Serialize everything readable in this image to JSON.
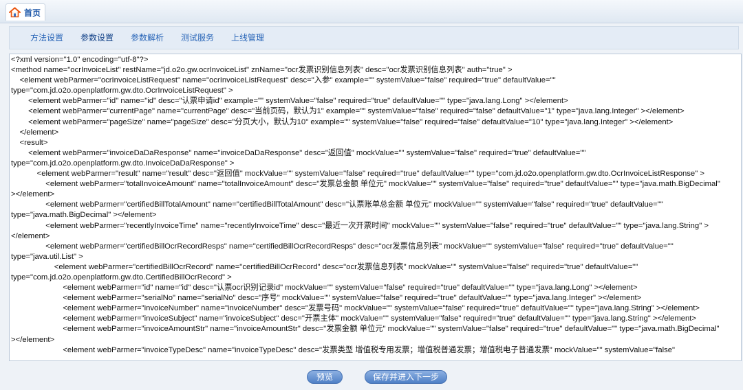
{
  "header": {
    "home_label": "首页",
    "home_icon": "home-icon"
  },
  "tabs": [
    {
      "label": "方法设置"
    },
    {
      "label": "参数设置"
    },
    {
      "label": "参数解析"
    },
    {
      "label": "测试服务"
    },
    {
      "label": "上线管理"
    }
  ],
  "active_tab": "参数设置",
  "editor": {
    "content": "<?xml version=\"1.0\" encoding=\"utf-8\"?>\n<method name=\"ocrInvoiceList\" restName=\"jd.o2o.gw.ocrInvoiceList\" znName=\"ocr发票识别信息列表\" desc=\"ocr发票识别信息列表\" auth=\"true\" >\n    <element webParmer=\"ocrInvoiceListRequest\" name=\"ocrInvoiceListRequest\" desc=\"入参\" example=\"\" systemValue=\"false\" required=\"true\" defaultValue=\"\"\ntype=\"com.jd.o2o.openplatform.gw.dto.OcrInvoiceListRequest\" >\n        <element webParmer=\"id\" name=\"id\" desc=\"认票申请id\" example=\"\" systemValue=\"false\" required=\"true\" defaultValue=\"\" type=\"java.lang.Long\" ></element>\n        <element webParmer=\"currentPage\" name=\"currentPage\" desc=\"当前页码，默认为1\" example=\"\" systemValue=\"false\" required=\"false\" defaultValue=\"1\" type=\"java.lang.Integer\" ></element>\n        <element webParmer=\"pageSize\" name=\"pageSize\" desc=\"分页大小，默认为10\" example=\"\" systemValue=\"false\" required=\"false\" defaultValue=\"10\" type=\"java.lang.Integer\" ></element>\n    </element>\n    <result>\n        <element webParmer=\"invoiceDaDaResponse\" name=\"invoiceDaDaResponse\" desc=\"返回值\" mockValue=\"\" systemValue=\"false\" required=\"true\" defaultValue=\"\"\ntype=\"com.jd.o2o.openplatform.gw.dto.InvoiceDaDaResponse\" >\n            <element webParmer=\"result\" name=\"result\" desc=\"返回值\" mockValue=\"\" systemValue=\"false\" required=\"true\" defaultValue=\"\" type=\"com.jd.o2o.openplatform.gw.dto.OcrInvoiceListResponse\" >\n                <element webParmer=\"totalInvoiceAmount\" name=\"totalInvoiceAmount\" desc=\"发票总金额 单位元\" mockValue=\"\" systemValue=\"false\" required=\"true\" defaultValue=\"\" type=\"java.math.BigDecimal\"\n></element>\n                <element webParmer=\"certifiedBillTotalAmount\" name=\"certifiedBillTotalAmount\" desc=\"认票账单总金额 单位元\" mockValue=\"\" systemValue=\"false\" required=\"true\" defaultValue=\"\"\ntype=\"java.math.BigDecimal\" ></element>\n                <element webParmer=\"recentlyInvoiceTime\" name=\"recentlyInvoiceTime\" desc=\"最近一次开票时间\" mockValue=\"\" systemValue=\"false\" required=\"true\" defaultValue=\"\" type=\"java.lang.String\" >\n</element>\n                <element webParmer=\"certifiedBillOcrRecordResps\" name=\"certifiedBillOcrRecordResps\" desc=\"ocr发票信息列表\" mockValue=\"\" systemValue=\"false\" required=\"true\" defaultValue=\"\"\ntype=\"java.util.List\" >\n                    <element webParmer=\"certifiedBillOcrRecord\" name=\"certifiedBillOcrRecord\" desc=\"ocr发票信息列表\" mockValue=\"\" systemValue=\"false\" required=\"true\" defaultValue=\"\"\ntype=\"com.jd.o2o.openplatform.gw.dto.CertifiedBillOcrRecord\" >\n                        <element webParmer=\"id\" name=\"id\" desc=\"认票ocr识别记录id\" mockValue=\"\" systemValue=\"false\" required=\"true\" defaultValue=\"\" type=\"java.lang.Long\" ></element>\n                        <element webParmer=\"serialNo\" name=\"serialNo\" desc=\"序号\" mockValue=\"\" systemValue=\"false\" required=\"true\" defaultValue=\"\" type=\"java.lang.Integer\" ></element>\n                        <element webParmer=\"invoiceNumber\" name=\"invoiceNumber\" desc=\"发票号码\" mockValue=\"\" systemValue=\"false\" required=\"true\" defaultValue=\"\" type=\"java.lang.String\" ></element>\n                        <element webParmer=\"invoiceSubject\" name=\"invoiceSubject\" desc=\"开票主体\" mockValue=\"\" systemValue=\"false\" required=\"true\" defaultValue=\"\" type=\"java.lang.String\" ></element>\n                        <element webParmer=\"invoiceAmountStr\" name=\"invoiceAmountStr\" desc=\"发票金额 单位元\" mockValue=\"\" systemValue=\"false\" required=\"true\" defaultValue=\"\" type=\"java.math.BigDecimal\"\n></element>\n                        <element webParmer=\"invoiceTypeDesc\" name=\"invoiceTypeDesc\" desc=\"发票类型 增值税专用发票；增值税普通发票；增值税电子普通发票\" mockValue=\"\" systemValue=\"false\""
  },
  "buttons": {
    "preview": "预览",
    "save_next": "保存并进入下一步"
  },
  "colors": {
    "accent": "#2a66b8",
    "button": "#5a8ad0",
    "home_icon": "#e9530e"
  }
}
